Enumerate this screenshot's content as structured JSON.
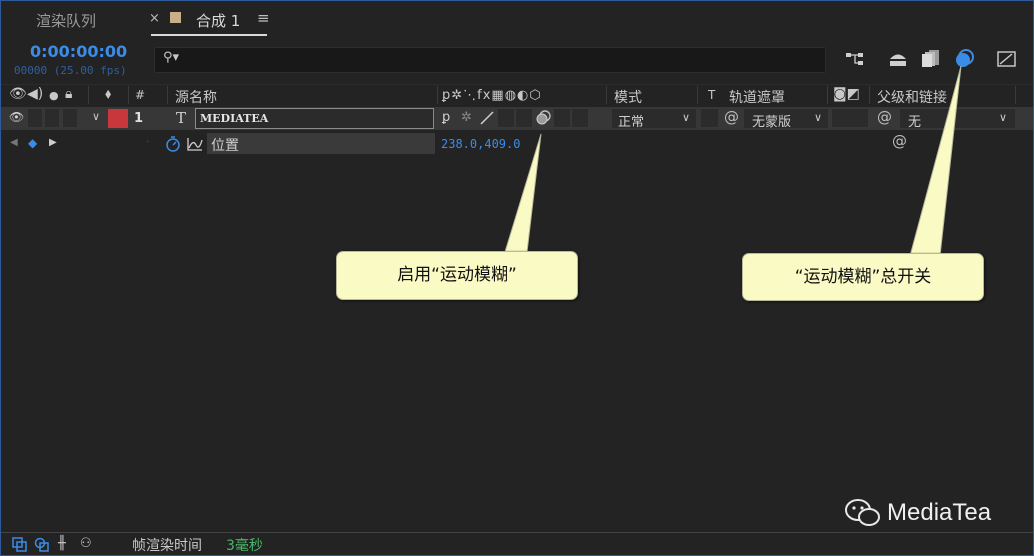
{
  "tabs": {
    "render_queue": "渲染队列",
    "comp_close": "×",
    "comp_name": "合成 1",
    "menu": "≡"
  },
  "timecode": {
    "time": "0:00:00:00",
    "frames_fps": "00000 (25.00 fps)"
  },
  "search": {
    "placeholder": "",
    "icon": "search-icon"
  },
  "columns": {
    "number": "#",
    "source_name": "源名称",
    "mode": "模式",
    "t": "T",
    "track_matte": "轨道遮罩",
    "parent": "父级和链接"
  },
  "layer": {
    "index": "1",
    "type_glyph": "T",
    "name": "MEDIATEA",
    "mode": "正常",
    "track_matte": "无蒙版",
    "parent": "无",
    "label_color": "#c8373c"
  },
  "property": {
    "name": "位置",
    "value": "238.0,409.0"
  },
  "annotations": {
    "enable_motion_blur": "启用“运动模糊”",
    "motion_blur_master": "“运动模糊”总开关"
  },
  "status": {
    "frame_render_label": "帧渲染时间",
    "frame_render_value": "3毫秒"
  },
  "watermark": "MediaTea",
  "colors": {
    "accent": "#3b8ce6",
    "annotation_bg": "#fafac5",
    "highlight": "#4aa0ff"
  }
}
